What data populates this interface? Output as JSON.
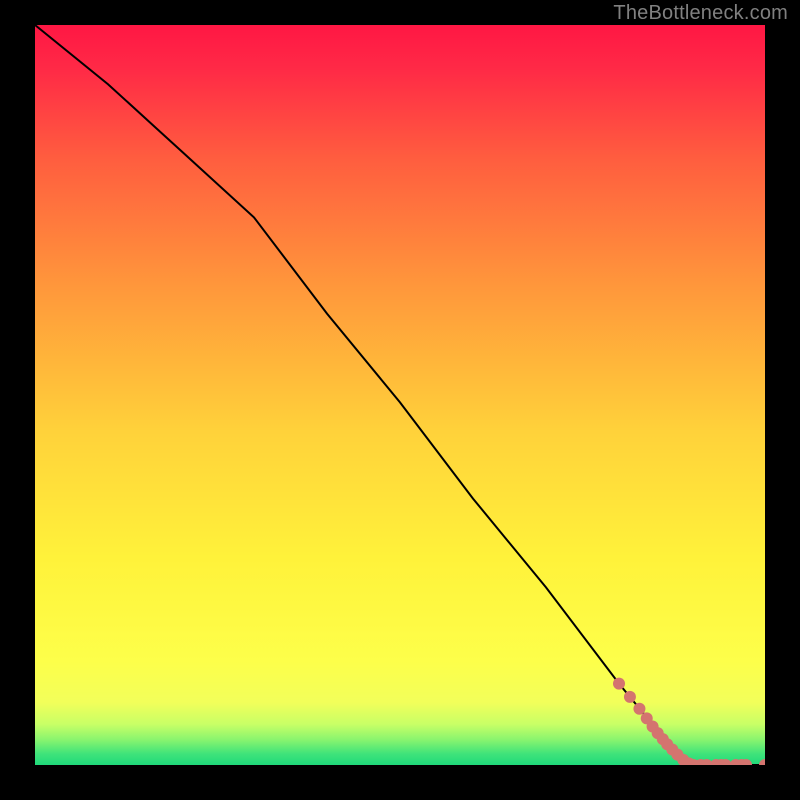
{
  "watermark": "TheBottleneck.com",
  "chart_data": {
    "type": "line",
    "title": "",
    "xlabel": "",
    "ylabel": "",
    "xlim": [
      0,
      100
    ],
    "ylim": [
      0,
      100
    ],
    "grid": false,
    "legend": false,
    "notes": "Background is a vertical red→orange→yellow→green gradient with green compressed near the bottom. A single black curve descends from top-left, changes slope around x≈30, continues nearly straight to ~x≈90 where it flattens to y≈0. Salmon-colored markers cluster along the lower-right portion of the line.",
    "series": [
      {
        "name": "curve",
        "x": [
          0,
          10,
          20,
          30,
          40,
          50,
          60,
          70,
          80,
          85,
          90,
          95,
          100
        ],
        "y": [
          100,
          92,
          83,
          74,
          61,
          49,
          36,
          24,
          11,
          5,
          0,
          0,
          0
        ]
      }
    ],
    "markers": [
      {
        "name": "dots-descending",
        "color": "#d4746f",
        "x": [
          80.0,
          81.5,
          82.8,
          83.8,
          84.6,
          85.3,
          86.0,
          86.6,
          87.3,
          88.0,
          88.8,
          89.6
        ],
        "y": [
          11.0,
          9.2,
          7.6,
          6.3,
          5.2,
          4.3,
          3.5,
          2.8,
          2.1,
          1.4,
          0.7,
          0.2
        ]
      },
      {
        "name": "dots-flat",
        "color": "#d4746f",
        "x": [
          90.2,
          91.2,
          92.0,
          93.3,
          94.0,
          94.6,
          96.0,
          96.8,
          97.4,
          100.0
        ],
        "y": [
          0,
          0,
          0,
          0,
          0,
          0,
          0,
          0,
          0,
          0
        ]
      }
    ],
    "gradient_stops": [
      {
        "offset": 0.0,
        "color": "#ff1744"
      },
      {
        "offset": 0.06,
        "color": "#ff2a46"
      },
      {
        "offset": 0.18,
        "color": "#ff5d3f"
      },
      {
        "offset": 0.35,
        "color": "#ff963b"
      },
      {
        "offset": 0.55,
        "color": "#ffd23a"
      },
      {
        "offset": 0.72,
        "color": "#fff23a"
      },
      {
        "offset": 0.86,
        "color": "#fdff4a"
      },
      {
        "offset": 0.915,
        "color": "#f2ff5a"
      },
      {
        "offset": 0.945,
        "color": "#c8ff66"
      },
      {
        "offset": 0.965,
        "color": "#8cf56e"
      },
      {
        "offset": 0.985,
        "color": "#3fe37a"
      },
      {
        "offset": 1.0,
        "color": "#1fd97a"
      }
    ]
  }
}
